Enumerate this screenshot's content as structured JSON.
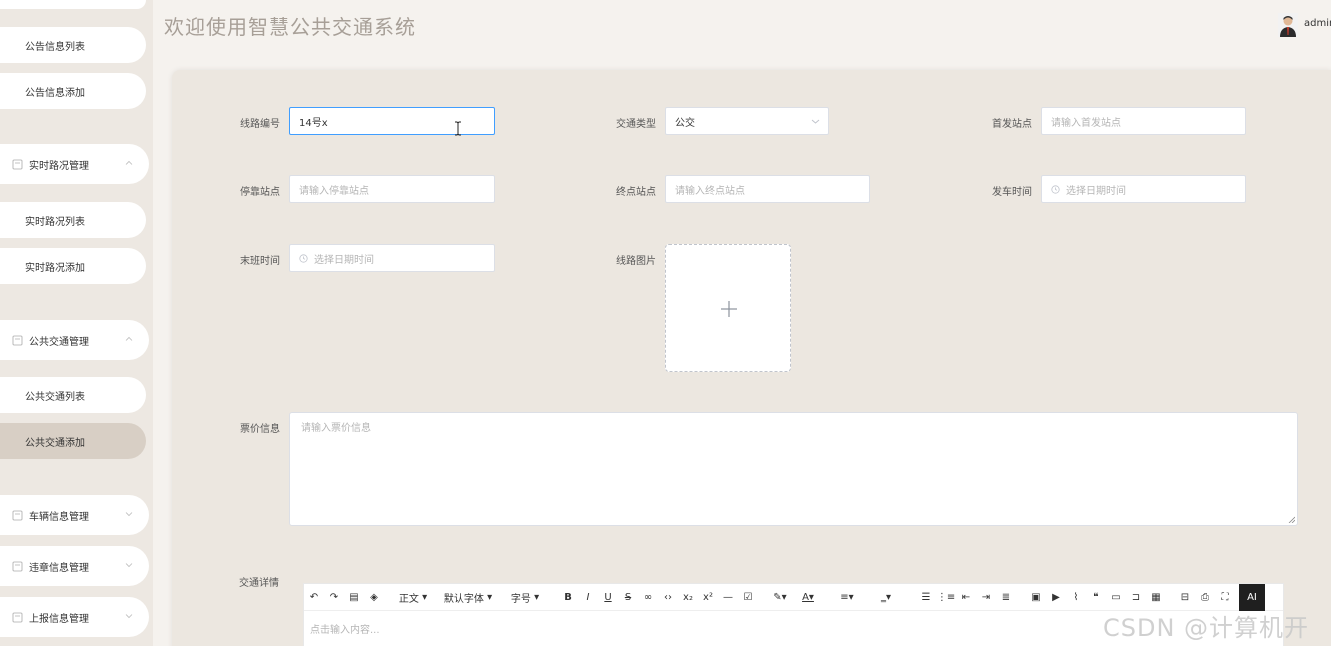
{
  "header": {
    "title": "欢迎使用智慧公共交通系统",
    "username": "admin"
  },
  "sidebar": {
    "items": [
      {
        "label": "公告信息列表",
        "type": "sub"
      },
      {
        "label": "公告信息添加",
        "type": "sub"
      },
      {
        "label": "实时路况管理",
        "type": "group"
      },
      {
        "label": "实时路况列表",
        "type": "sub"
      },
      {
        "label": "实时路况添加",
        "type": "sub"
      },
      {
        "label": "公共交通管理",
        "type": "group"
      },
      {
        "label": "公共交通列表",
        "type": "sub"
      },
      {
        "label": "公共交通添加",
        "type": "sub",
        "active": true
      },
      {
        "label": "车辆信息管理",
        "type": "group"
      },
      {
        "label": "违章信息管理",
        "type": "group"
      },
      {
        "label": "上报信息管理",
        "type": "group"
      }
    ]
  },
  "form": {
    "route_no": {
      "label": "线路编号",
      "value": "14号x"
    },
    "transport_type": {
      "label": "交通类型",
      "value": "公交"
    },
    "first_station": {
      "label": "首发站点",
      "placeholder": "请输入首发站点"
    },
    "stop_station": {
      "label": "停靠站点",
      "placeholder": "请输入停靠站点"
    },
    "end_station": {
      "label": "终点站点",
      "placeholder": "请输入终点站点"
    },
    "depart_time": {
      "label": "发车时间",
      "placeholder": "选择日期时间"
    },
    "last_time": {
      "label": "末班时间",
      "placeholder": "选择日期时间"
    },
    "route_image": {
      "label": "线路图片"
    },
    "fare": {
      "label": "票价信息",
      "placeholder": "请输入票价信息"
    },
    "details": {
      "label": "交通详情",
      "placeholder": "点击输入内容..."
    }
  },
  "toolbar": {
    "paragraph": "正文",
    "font": "默认字体",
    "size": "字号",
    "ai": "AI"
  },
  "watermark": "CSDN @计算机开发",
  "colors": {
    "accent": "#409eff",
    "sidebar_active": "#d8cfc5",
    "panel": "#ece7e0"
  }
}
